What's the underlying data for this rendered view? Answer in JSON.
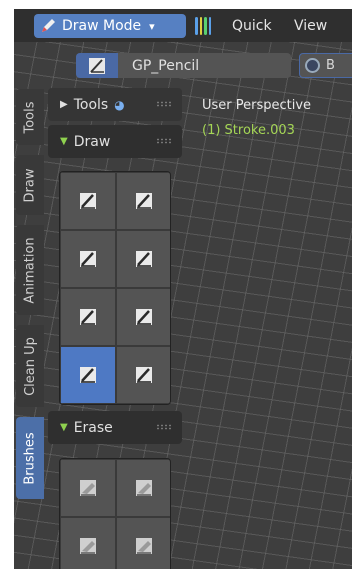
{
  "header": {
    "mode_label": "Draw Mode",
    "menu": [
      "Quick",
      "View"
    ]
  },
  "subbar": {
    "material_name": "GP_Pencil",
    "second_field_label": "B"
  },
  "tabs": [
    {
      "label": "Tools",
      "active": false
    },
    {
      "label": "Draw",
      "active": false
    },
    {
      "label": "Animation",
      "active": false
    },
    {
      "label": "Clean Up",
      "active": false
    },
    {
      "label": "Brushes",
      "active": true
    }
  ],
  "panels": {
    "tools": {
      "label": "Tools",
      "expanded": false
    },
    "draw": {
      "label": "Draw",
      "expanded": true,
      "brush_count": 8,
      "selected_index": 6
    },
    "erase": {
      "label": "Erase",
      "expanded": true,
      "brush_count": 4
    }
  },
  "viewport": {
    "perspective": "User Perspective",
    "object": "(1) Stroke.003"
  },
  "colors": {
    "accent": "#5680c2",
    "object_text": "#a5d656"
  }
}
